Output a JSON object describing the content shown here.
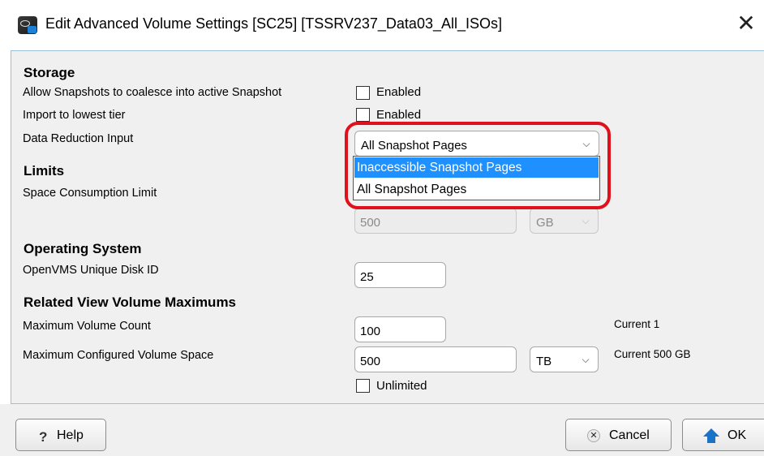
{
  "window": {
    "title": "Edit Advanced Volume Settings [SC25] [TSSRV237_Data03_All_ISOs]",
    "close_glyph": "✕"
  },
  "storage": {
    "heading": "Storage",
    "allow_snapshots_label": "Allow Snapshots to coalesce into active Snapshot",
    "allow_snapshots_checkbox": "Enabled",
    "import_lowest_label": "Import to lowest tier",
    "import_lowest_checkbox": "Enabled",
    "data_reduction_label": "Data Reduction Input",
    "data_reduction_value": "All Snapshot Pages",
    "data_reduction_options": [
      "Inaccessible Snapshot Pages",
      "All Snapshot Pages"
    ]
  },
  "limits": {
    "heading": "Limits",
    "space_consumption_label": "Space Consumption Limit",
    "space_value": "500",
    "space_unit": "GB"
  },
  "operating_system": {
    "heading": "Operating System",
    "openvms_label": "OpenVMS Unique Disk ID",
    "openvms_value": "25"
  },
  "related_view": {
    "heading": "Related View Volume Maximums",
    "max_count_label": "Maximum Volume Count",
    "max_count_value": "100",
    "max_count_current": "Current 1",
    "max_space_label": "Maximum Configured Volume Space",
    "max_space_value": "500",
    "max_space_unit": "TB",
    "max_space_current": "Current 500 GB",
    "unlimited_checkbox": "Unlimited"
  },
  "buttons": {
    "help": "Help",
    "cancel": "Cancel",
    "ok": "OK"
  },
  "icons": {
    "app": "dell-storage-app-icon",
    "help": "question-icon",
    "cancel": "x-circle-icon",
    "ok": "up-arrow-icon"
  },
  "colors": {
    "highlight": "#e0101c",
    "selection": "#1e90ff",
    "ok_arrow": "#1a73c7"
  }
}
